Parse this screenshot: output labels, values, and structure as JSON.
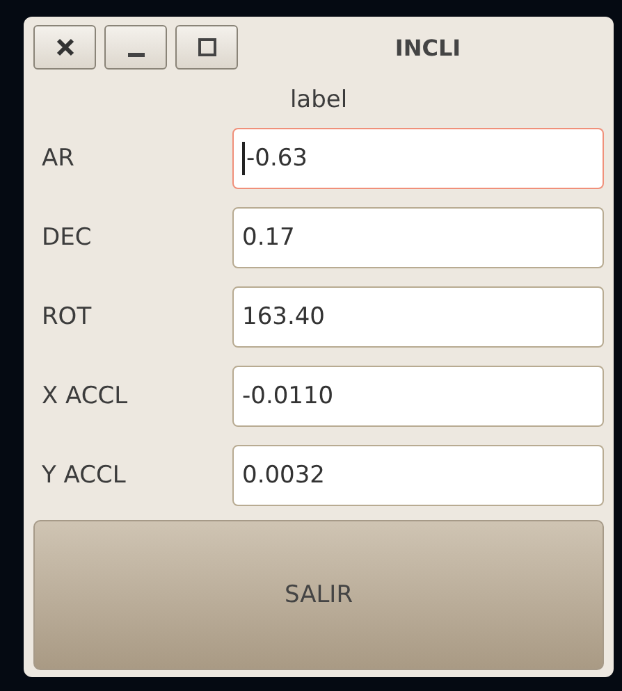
{
  "window": {
    "title": "INCLI",
    "controls": [
      {
        "kind": "close"
      },
      {
        "kind": "minimize"
      },
      {
        "kind": "maximize"
      }
    ]
  },
  "header_label": "label",
  "fields": [
    {
      "label": "AR",
      "value": "-0.63",
      "focused": true
    },
    {
      "label": "DEC",
      "value": "0.17",
      "focused": false
    },
    {
      "label": "ROT",
      "value": "163.40",
      "focused": false
    },
    {
      "label": "X ACCL",
      "value": "-0.0110",
      "focused": false
    },
    {
      "label": "Y ACCL",
      "value": "0.0032",
      "focused": false
    }
  ],
  "button": "SALIR"
}
